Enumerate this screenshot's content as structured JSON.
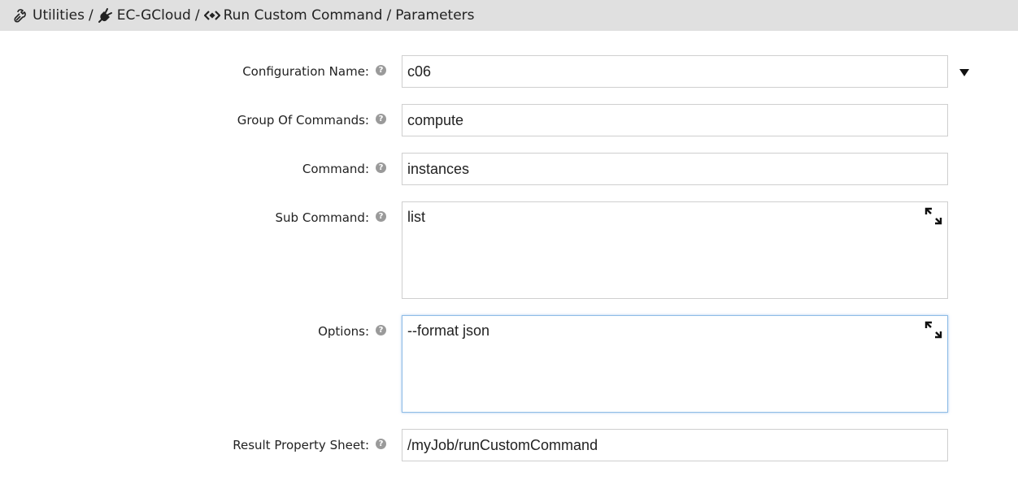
{
  "breadcrumb": {
    "items": [
      {
        "label": "Utilities",
        "icon": "utilities-icon"
      },
      {
        "label": "EC-GCloud",
        "icon": "plug-icon"
      },
      {
        "label": "Run Custom Command",
        "icon": "code-icon"
      },
      {
        "label": "Parameters",
        "icon": ""
      }
    ],
    "separator": "/"
  },
  "form": {
    "configuration_name": {
      "label": "Configuration Name:",
      "value": "c06"
    },
    "group_of_commands": {
      "label": "Group Of Commands:",
      "value": "compute"
    },
    "command": {
      "label": "Command:",
      "value": "instances"
    },
    "sub_command": {
      "label": "Sub Command:",
      "value": "list"
    },
    "options": {
      "label": "Options:",
      "value": "--format json"
    },
    "result_property_sheet": {
      "label": "Result Property Sheet:",
      "value": "/myJob/runCustomCommand"
    }
  },
  "help_glyph": "?"
}
